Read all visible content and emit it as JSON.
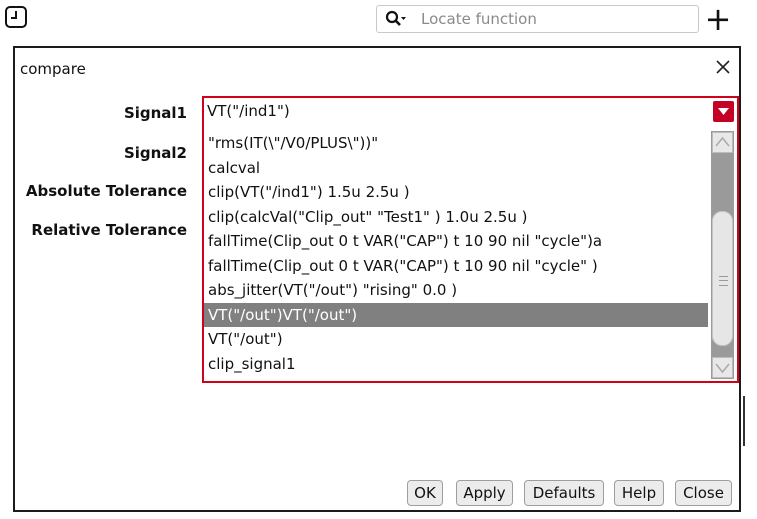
{
  "toolbar": {
    "clock_icon": "clock-icon",
    "search_placeholder": "Locate function",
    "search_icon": "search-icon",
    "add_label": "+"
  },
  "dialog": {
    "title": "compare",
    "close_icon": "close-icon",
    "fields": {
      "signal1_label": "Signal1",
      "signal2_label": "Signal2",
      "abs_tol_label": "Absolute Tolerance",
      "rel_tol_label": "Relative Tolerance"
    },
    "combo": {
      "value": "VT(\"/ind1\")",
      "accent": "#c40024",
      "options": [
        "\"rms(IT(\\\"/V0/PLUS\\\"))\"",
        "calcval",
        "clip(VT(\"/ind1\") 1.5u 2.5u )",
        "clip(calcVal(\"Clip_out\" \"Test1\" ) 1.0u 2.5u )",
        "fallTime(Clip_out 0 t VAR(\"CAP\") t 10 90 nil \"cycle\")a",
        "fallTime(Clip_out 0 t VAR(\"CAP\") t 10 90 nil \"cycle\" )",
        "abs_jitter(VT(\"/out\") \"rising\" 0.0 )",
        "VT(\"/out\")VT(\"/out\")",
        "VT(\"/out\")",
        "clip_signal1"
      ],
      "selected_index": 7
    },
    "buttons": {
      "ok": "OK",
      "apply": "Apply",
      "defaults": "Defaults",
      "help": "Help",
      "close": "Close"
    }
  }
}
